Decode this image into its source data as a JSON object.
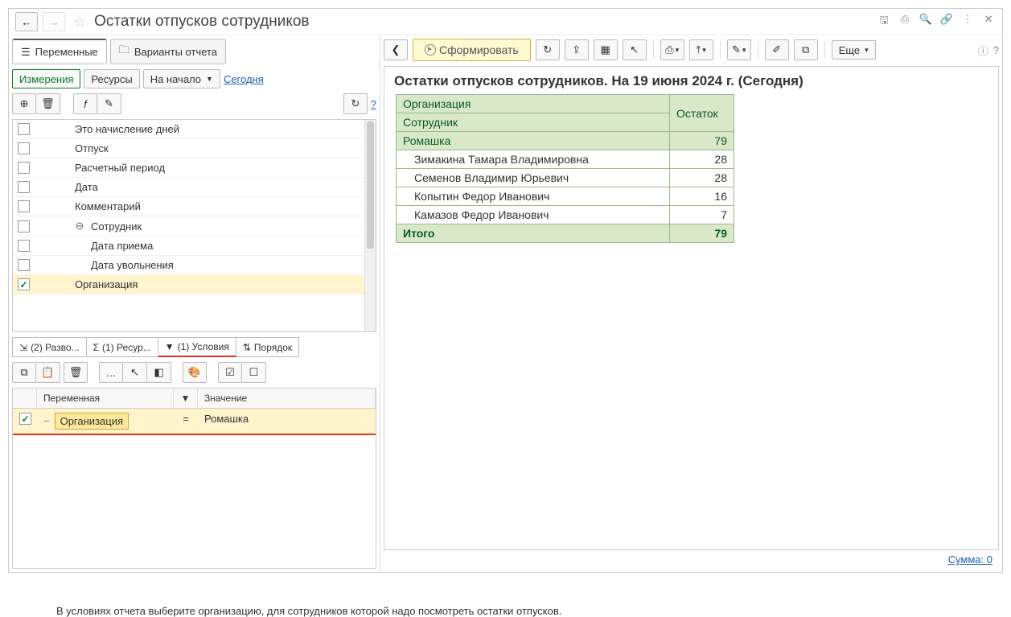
{
  "title": "Остатки отпусков сотрудников",
  "tabs": {
    "variables": "Переменные",
    "variants": "Варианты отчета"
  },
  "toolbar": {
    "dimensions": "Измерения",
    "resources": "Ресурсы",
    "at_start": "На начало",
    "today": "Сегодня"
  },
  "tree": {
    "items": [
      {
        "label": "Это начисление дней",
        "indent": 0,
        "checked": false
      },
      {
        "label": "Отпуск",
        "indent": 0,
        "checked": false
      },
      {
        "label": "Расчетный период",
        "indent": 0,
        "checked": false
      },
      {
        "label": "Дата",
        "indent": 0,
        "checked": false
      },
      {
        "label": "Комментарий",
        "indent": 0,
        "checked": false
      },
      {
        "label": "Сотрудник",
        "indent": 0,
        "checked": false,
        "expandable": true
      },
      {
        "label": "Дата приема",
        "indent": 1,
        "checked": false
      },
      {
        "label": "Дата увольнения",
        "indent": 1,
        "checked": false
      },
      {
        "label": "Организация",
        "indent": 0,
        "checked": true,
        "selected": true
      }
    ]
  },
  "bottom_tabs": {
    "expand": "(2) Разво...",
    "resources": "(1) Ресур...",
    "conditions": "(1) Условия",
    "order": "Порядок"
  },
  "conditions": {
    "col_variable": "Переменная",
    "col_value": "Значение",
    "row": {
      "variable": "Организация",
      "op": "=",
      "value": "Ромашка"
    }
  },
  "right": {
    "form": "Сформировать",
    "more": "Еще"
  },
  "report": {
    "title": "Остатки отпусков сотрудников. На 19 июня 2024 г. (Сегодня)",
    "col1_a": "Организация",
    "col1_b": "Сотрудник",
    "col2": "Остаток",
    "group": {
      "name": "Ромашка",
      "value": "79"
    },
    "rows": [
      {
        "name": "Зимакина Тамара Владимировна",
        "value": "28"
      },
      {
        "name": "Семенов Владимир Юрьевич",
        "value": "28"
      },
      {
        "name": "Копытин Федор Иванович",
        "value": "16"
      },
      {
        "name": "Камазов Федор Иванович",
        "value": "7"
      }
    ],
    "total_label": "Итого",
    "total_value": "79"
  },
  "footer": {
    "sum": "Сумма: 0"
  },
  "caption": "В условиях отчета выберите организацию, для сотрудников которой надо посмотреть остатки отпусков."
}
